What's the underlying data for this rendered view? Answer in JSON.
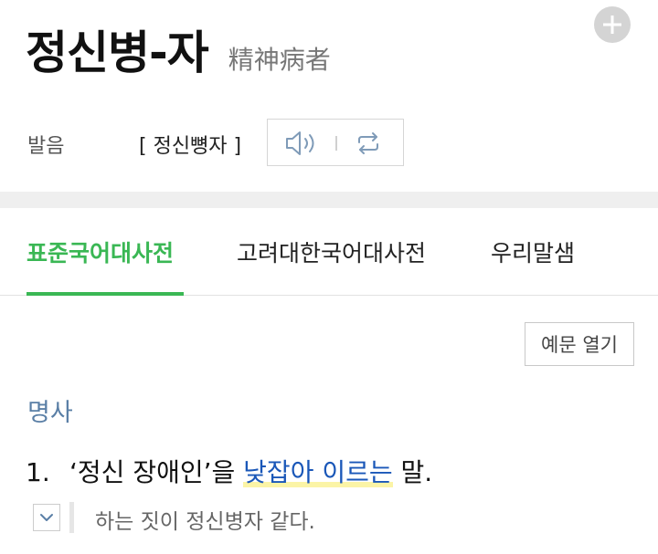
{
  "entry": {
    "headword": "정신병-자",
    "hanja": "精神病者"
  },
  "pronunciation": {
    "label": "발음",
    "text": "[ 정신뼝자 ]"
  },
  "tabs": [
    {
      "label": "표준국어대사전",
      "active": true
    },
    {
      "label": "고려대한국어대사전",
      "active": false
    },
    {
      "label": "우리말샘",
      "active": false
    }
  ],
  "example_button": {
    "label": "예문 열기"
  },
  "definition": {
    "part_of_speech": "명사",
    "number": "1.",
    "text_before": "‘정신 장애인’을 ",
    "link_text": "낮잡아 이르는",
    "text_after": " 말.",
    "example": "하는 짓이 정신병자 같다."
  },
  "icons": {
    "add": "plus-icon",
    "audio": "speaker-icon",
    "repeat": "repeat-icon",
    "expand": "chevron-down-icon"
  },
  "colors": {
    "accent_green": "#3ab754",
    "link_blue": "#1a57b8",
    "pos_blue": "#5a7fa6",
    "highlight_yellow": "#fbf4a6"
  }
}
